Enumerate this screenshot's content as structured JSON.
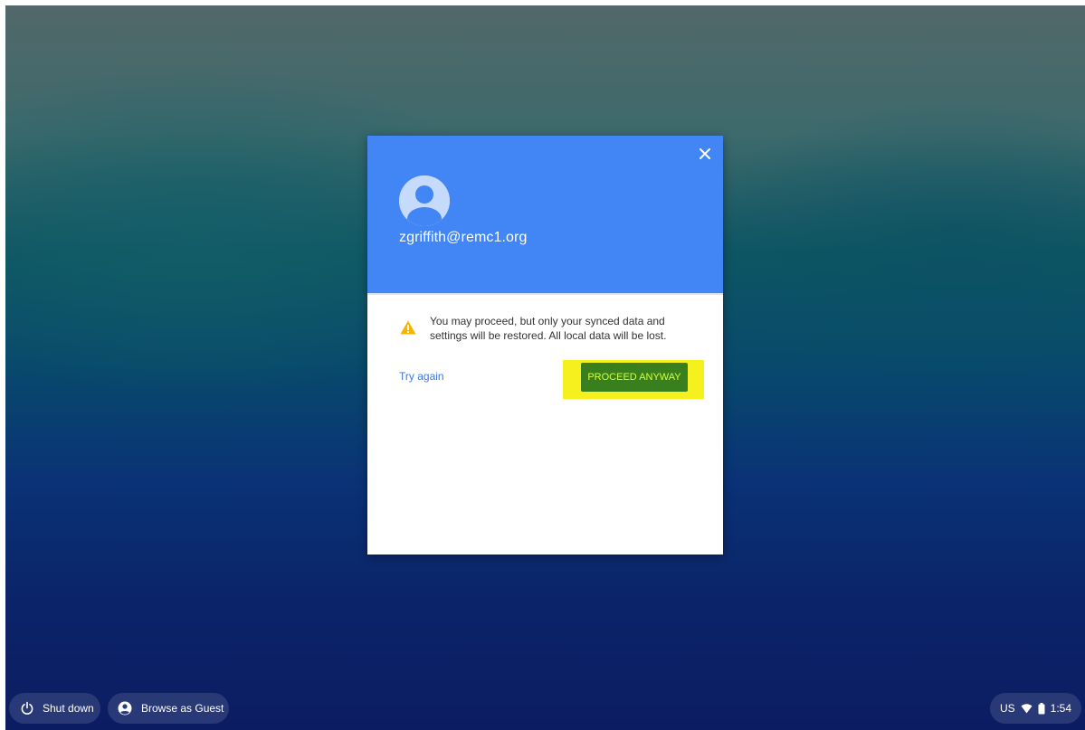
{
  "dialog": {
    "email": "zgriffith@remc1.org",
    "warning": "You may proceed, but only your synced data and settings will be restored. All local data will be lost.",
    "try_again_label": "Try again",
    "proceed_label": "PROCEED ANYWAY",
    "icons": {
      "close": "close-icon",
      "avatar": "avatar-icon",
      "warning": "warning-icon"
    }
  },
  "shelf": {
    "shutdown_label": "Shut down",
    "guest_label": "Browse as Guest",
    "status": {
      "keyboard_layout": "US",
      "time": "1:54",
      "icons": [
        "wifi-icon",
        "battery-icon"
      ]
    }
  },
  "colors": {
    "header": "#4285f4",
    "link": "#3b78e7",
    "highlight": "#f5f01e",
    "proceed_button": "#3a7f1e",
    "warning": "#f4b400"
  }
}
